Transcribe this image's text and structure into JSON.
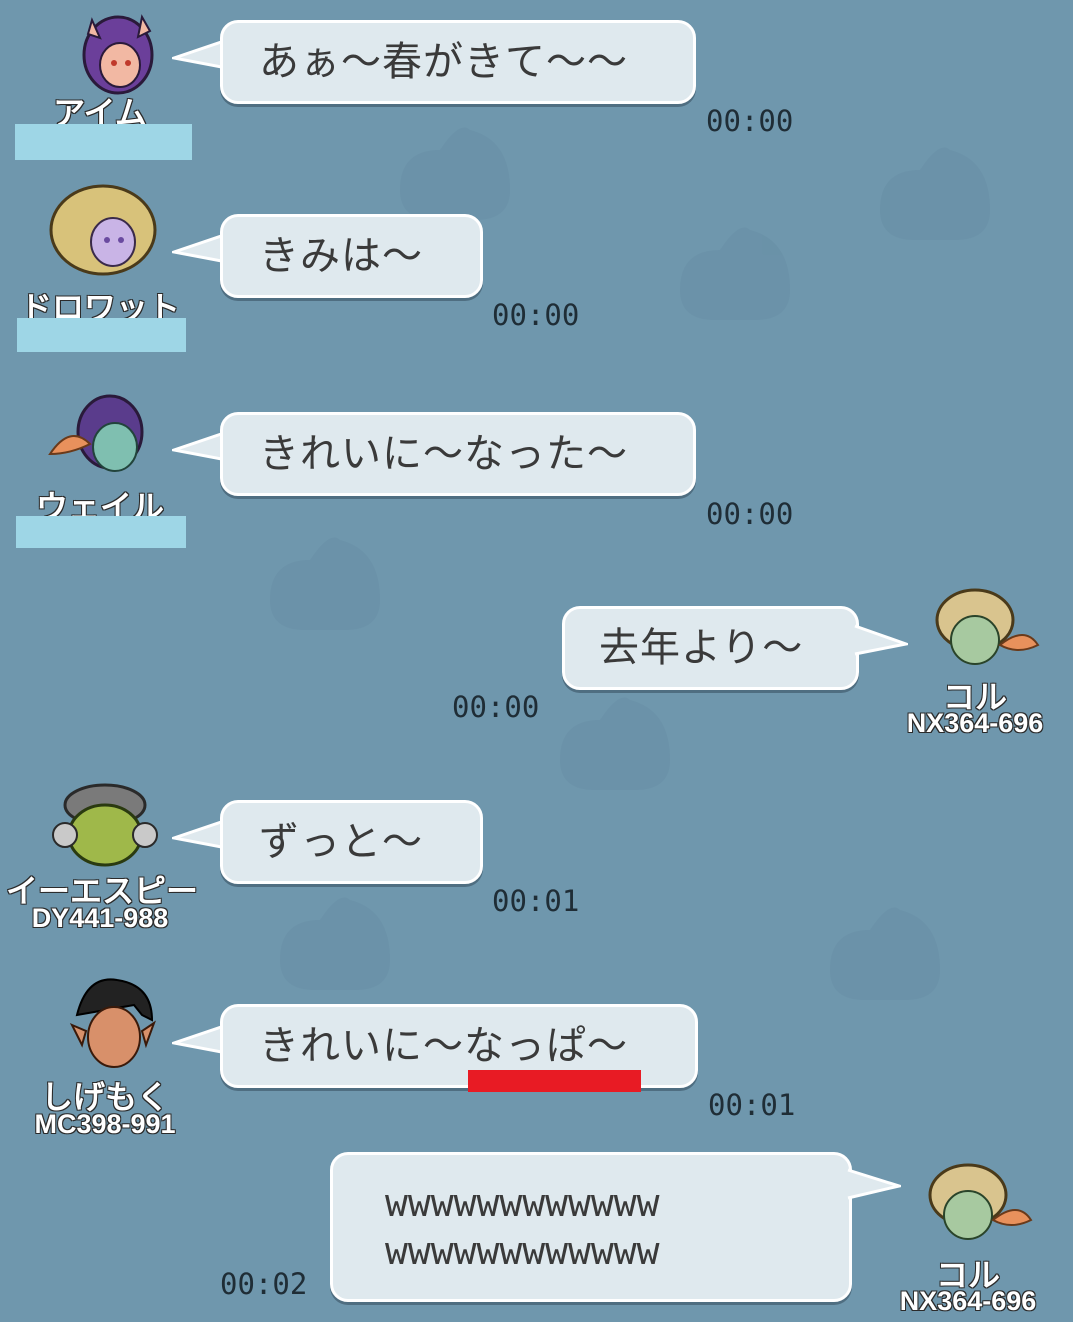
{
  "colors": {
    "background": "#6f97ad",
    "bubble_fill": "#dfe9ee",
    "bubble_border": "#ffffff",
    "mask": "#9ed6e6",
    "underline": "#e81b24"
  },
  "messages": [
    {
      "text": "あぁ～春がきて～～",
      "time": "00:00",
      "sender": {
        "name": "アイム",
        "id": "",
        "avatar": "purple-hair-horns-avatar"
      }
    },
    {
      "text": "きみは～",
      "time": "00:00",
      "sender": {
        "name": "ドロワット",
        "id": "",
        "avatar": "blonde-curly-elf-avatar"
      }
    },
    {
      "text": "きれいに～なった～",
      "time": "00:00",
      "sender": {
        "name": "ウェイル",
        "id": "",
        "avatar": "purple-hair-fin-avatar"
      }
    },
    {
      "text": "去年より～",
      "time": "00:00",
      "sender": {
        "name": "コル",
        "id": "NX364-696",
        "avatar": "blonde-fin-avatar"
      }
    },
    {
      "text": "ずっと～",
      "time": "00:01",
      "sender": {
        "name": "イーエスピー",
        "id": "DY441-988",
        "avatar": "green-ogre-avatar"
      }
    },
    {
      "text": "きれいに～なっぱ～",
      "time": "00:01",
      "sender": {
        "name": "しげもく",
        "id": "MC398-991",
        "avatar": "black-hair-demon-avatar"
      }
    },
    {
      "text_line1": "wwwwwwwwwwww",
      "text_line2": "wwwwwwwwwwww",
      "time": "00:02",
      "sender": {
        "name": "コル",
        "id": "NX364-696",
        "avatar": "blonde-fin-avatar"
      }
    }
  ]
}
